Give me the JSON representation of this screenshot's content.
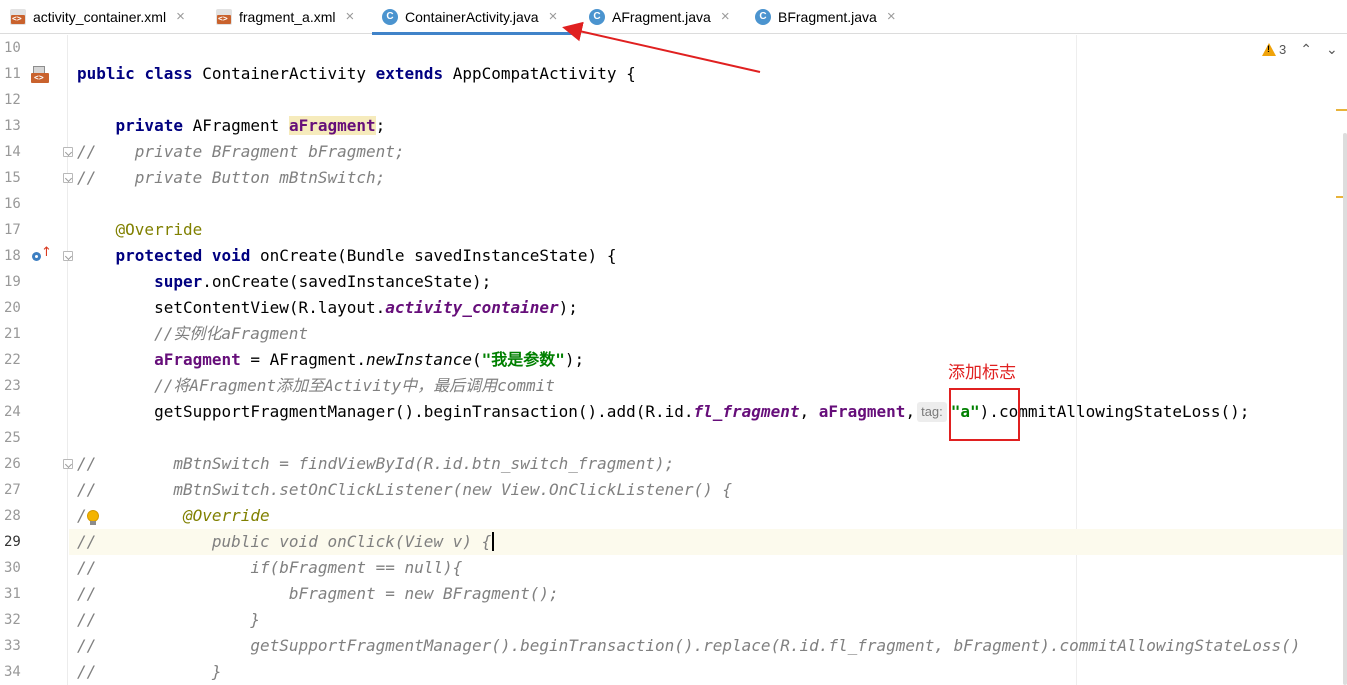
{
  "tabs": [
    {
      "label": "activity_container.xml",
      "icon": "xml-layout-icon",
      "active": false
    },
    {
      "label": "fragment_a.xml",
      "icon": "xml-layout-icon",
      "active": false
    },
    {
      "label": "ContainerActivity.java",
      "icon": "java-class-icon",
      "active": true
    },
    {
      "label": "AFragment.java",
      "icon": "java-class-icon",
      "active": false
    },
    {
      "label": "BFragment.java",
      "icon": "java-class-icon",
      "active": false
    }
  ],
  "tab_close_glyph": "×",
  "inspection": {
    "warning_count": "3",
    "nav_up": "^",
    "nav_down": "v"
  },
  "annotation": {
    "label": "添加标志",
    "color": "#e02020"
  },
  "caret_line": 29,
  "code": [
    {
      "n": "10",
      "t": []
    },
    {
      "n": "11",
      "t": [
        [
          "kw",
          "public"
        ],
        [
          "",
          "&nbsp;"
        ],
        [
          "kw",
          "class"
        ],
        [
          "",
          " ContainerActivity "
        ],
        [
          "kw",
          "extends"
        ],
        [
          "",
          " AppCompatActivity {"
        ]
      ]
    },
    {
      "n": "12",
      "t": []
    },
    {
      "n": "13",
      "t": [
        [
          "",
          "    "
        ],
        [
          "kw",
          "private"
        ],
        [
          "",
          " AFragment "
        ],
        [
          "field-hl",
          "aFragment"
        ],
        [
          "",
          ";"
        ]
      ]
    },
    {
      "n": "14",
      "t": [
        [
          "cmt",
          "//    private BFragment bFragment;"
        ]
      ]
    },
    {
      "n": "15",
      "t": [
        [
          "cmt",
          "//    private Button mBtnSwitch;"
        ]
      ]
    },
    {
      "n": "16",
      "t": []
    },
    {
      "n": "17",
      "t": [
        [
          "",
          "    "
        ],
        [
          "ann",
          "@Override"
        ]
      ]
    },
    {
      "n": "18",
      "t": [
        [
          "",
          "    "
        ],
        [
          "kw",
          "protected"
        ],
        [
          "",
          " "
        ],
        [
          "kw",
          "void"
        ],
        [
          "",
          " onCreate(Bundle savedInstanceState) {"
        ]
      ]
    },
    {
      "n": "19",
      "t": [
        [
          "",
          "        "
        ],
        [
          "kw",
          "super"
        ],
        [
          "",
          ".onCreate(savedInstanceState);"
        ]
      ]
    },
    {
      "n": "20",
      "t": [
        [
          "",
          "        setContentView(R.layout."
        ],
        [
          "static-it",
          "activity_container"
        ],
        [
          "",
          ");"
        ]
      ]
    },
    {
      "n": "21",
      "t": [
        [
          "",
          "        "
        ],
        [
          "cmt",
          "//实例化aFragment"
        ]
      ]
    },
    {
      "n": "22",
      "t": [
        [
          "",
          "        "
        ],
        [
          "field",
          "aFragment"
        ],
        [
          "",
          " = AFragment."
        ],
        [
          "method-it",
          "newInstance"
        ],
        [
          "",
          "("
        ],
        [
          "str",
          "\"我是参数\""
        ],
        [
          "",
          ");"
        ]
      ]
    },
    {
      "n": "23",
      "t": [
        [
          "",
          "        "
        ],
        [
          "cmt",
          "//将AFragment添加至Activity中，最后调用commit"
        ]
      ]
    },
    {
      "n": "24",
      "t": [
        [
          "",
          "        getSupportFragmentManager().beginTransaction().add(R.id."
        ],
        [
          "static-it",
          "fl_fragment"
        ],
        [
          "",
          ", "
        ],
        [
          "field",
          "aFragment"
        ],
        [
          "",
          ","
        ],
        [
          "hint",
          "tag:"
        ],
        [
          "str",
          "\"a\""
        ],
        [
          "",
          ").commitAllowingStateLoss();"
        ]
      ]
    },
    {
      "n": "25",
      "t": []
    },
    {
      "n": "26",
      "t": [
        [
          "cmt",
          "//        mBtnSwitch = findViewById(R.id.btn_switch_fragment);"
        ]
      ]
    },
    {
      "n": "27",
      "t": [
        [
          "cmt",
          "//        mBtnSwitch.setOnClickListener(new View.OnClickListener() {"
        ]
      ]
    },
    {
      "n": "28",
      "t": [
        [
          "cmt",
          "/"
        ],
        [
          "",
          "          "
        ],
        [
          "cmt-ann",
          "@Override"
        ]
      ]
    },
    {
      "n": "29",
      "t": [
        [
          "cmt",
          "//            public void onClick(View v) {"
        ],
        [
          "caret",
          ""
        ]
      ]
    },
    {
      "n": "30",
      "t": [
        [
          "cmt",
          "//                if(bFragment == null){"
        ]
      ]
    },
    {
      "n": "31",
      "t": [
        [
          "cmt",
          "//                    bFragment = new BFragment();"
        ]
      ]
    },
    {
      "n": "32",
      "t": [
        [
          "cmt",
          "//                }"
        ]
      ]
    },
    {
      "n": "33",
      "t": [
        [
          "cmt",
          "//                getSupportFragmentManager().beginTransaction().replace(R.id.fl_fragment, bFragment).commitAllowingStateLoss()"
        ]
      ]
    },
    {
      "n": "34",
      "t": [
        [
          "cmt",
          "//            }"
        ]
      ]
    }
  ]
}
